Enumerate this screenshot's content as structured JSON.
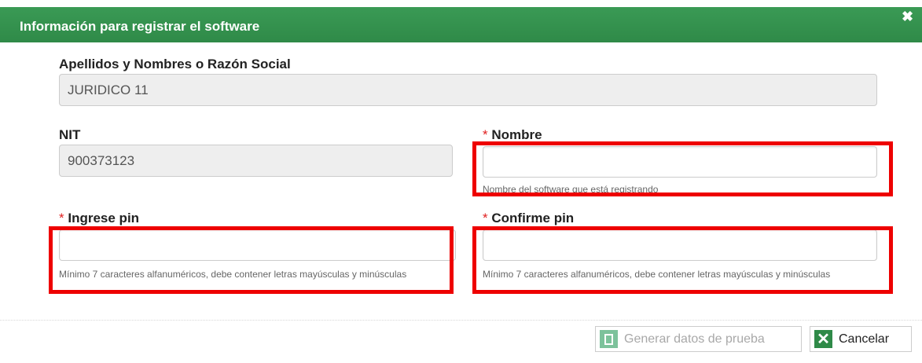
{
  "dialog": {
    "title": "Información para registrar el software",
    "close_glyph": "✖"
  },
  "form": {
    "razon_social": {
      "label": "Apellidos y Nombres o Razón Social",
      "value": "JURIDICO 11"
    },
    "nit": {
      "label": "NIT",
      "value": "900373123"
    },
    "nombre": {
      "required_mark": "*",
      "label": "Nombre",
      "value": "",
      "help": "Nombre del software que está registrando"
    },
    "ingrese_pin": {
      "required_mark": "*",
      "label": "Ingrese pin",
      "value": "",
      "help": "Mínimo 7 caracteres alfanuméricos, debe contener letras mayúsculas y minúsculas"
    },
    "confirme_pin": {
      "required_mark": "*",
      "label": "Confirme pin",
      "value": "",
      "help": "Mínimo 7 caracteres alfanuméricos, debe contener letras mayúsculas y minúsculas"
    }
  },
  "actions": {
    "generate_label": "Generar datos de prueba",
    "generate_icon": "document-icon",
    "cancel_label": "Cancelar",
    "cancel_icon": "close-x-icon"
  },
  "colors": {
    "header": "#2f8a48",
    "highlight": "#ee0000",
    "required": "#e02020"
  }
}
